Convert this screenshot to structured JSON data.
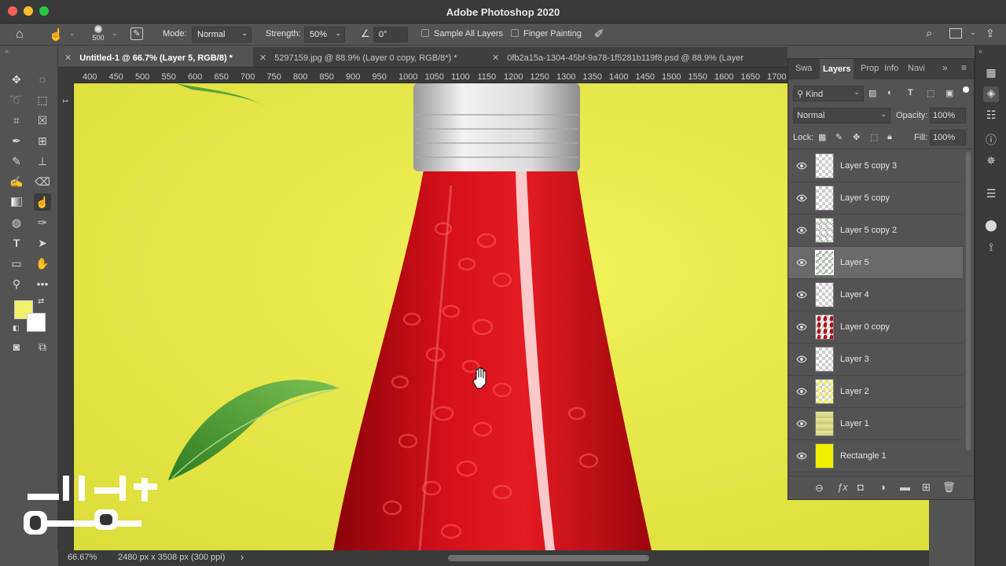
{
  "app": {
    "title": "Adobe Photoshop 2020"
  },
  "options_bar": {
    "brush_size": "500",
    "mode_label": "Mode:",
    "mode_value": "Normal",
    "strength_label": "Strength:",
    "strength_value": "50%",
    "angle_value": "0°",
    "sample_all_layers": "Sample All Layers",
    "finger_painting": "Finger Painting"
  },
  "tabs": [
    {
      "label": "Untitled-1 @ 66.7% (Layer 5, RGB/8) *",
      "active": true
    },
    {
      "label": "5297159.jpg @ 88.9% (Layer 0 copy, RGB/8*) *",
      "active": false
    },
    {
      "label": "0fb2a15a-1304-45bf-9a78-1f5281b119f8.psd @ 88.9% (Layer",
      "active": false
    }
  ],
  "ruler": {
    "ticks": [
      "400",
      "450",
      "500",
      "550",
      "600",
      "650",
      "700",
      "750",
      "800",
      "850",
      "900",
      "950",
      "1000",
      "1050",
      "1100",
      "1150",
      "1200",
      "1250",
      "1300",
      "1350",
      "1400",
      "1450",
      "1500",
      "1550",
      "1600",
      "1650",
      "1700"
    ]
  },
  "status": {
    "zoom": "66.67%",
    "doc_info": "2480 px x 3508 px (300 ppi)"
  },
  "panel": {
    "tabs": [
      "Swa",
      "Layers",
      "Prop",
      "Info",
      "Navi"
    ],
    "active_tab": "Layers",
    "filter_label": "Kind",
    "blend_mode": "Normal",
    "opacity_label": "Opacity:",
    "opacity_value": "100%",
    "lock_label": "Lock:",
    "fill_label": "Fill:",
    "fill_value": "100%",
    "layers": [
      {
        "name": "Layer 5 copy 3",
        "selected": false
      },
      {
        "name": "Layer 5 copy",
        "selected": false
      },
      {
        "name": "Layer 5 copy 2",
        "selected": false
      },
      {
        "name": "Layer 5",
        "selected": true
      },
      {
        "name": "Layer 4",
        "selected": false
      },
      {
        "name": "Layer 0 copy",
        "selected": false
      },
      {
        "name": "Layer 3",
        "selected": false
      },
      {
        "name": "Layer 2",
        "selected": false
      },
      {
        "name": "Layer 1",
        "selected": false
      },
      {
        "name": "Rectangle 1",
        "selected": false
      }
    ]
  },
  "colors": {
    "foreground": "#f4f06a",
    "background": "#ffffff",
    "canvas_bg": "#e8e84a"
  },
  "watermark": {
    "text": "الخلاصة"
  }
}
